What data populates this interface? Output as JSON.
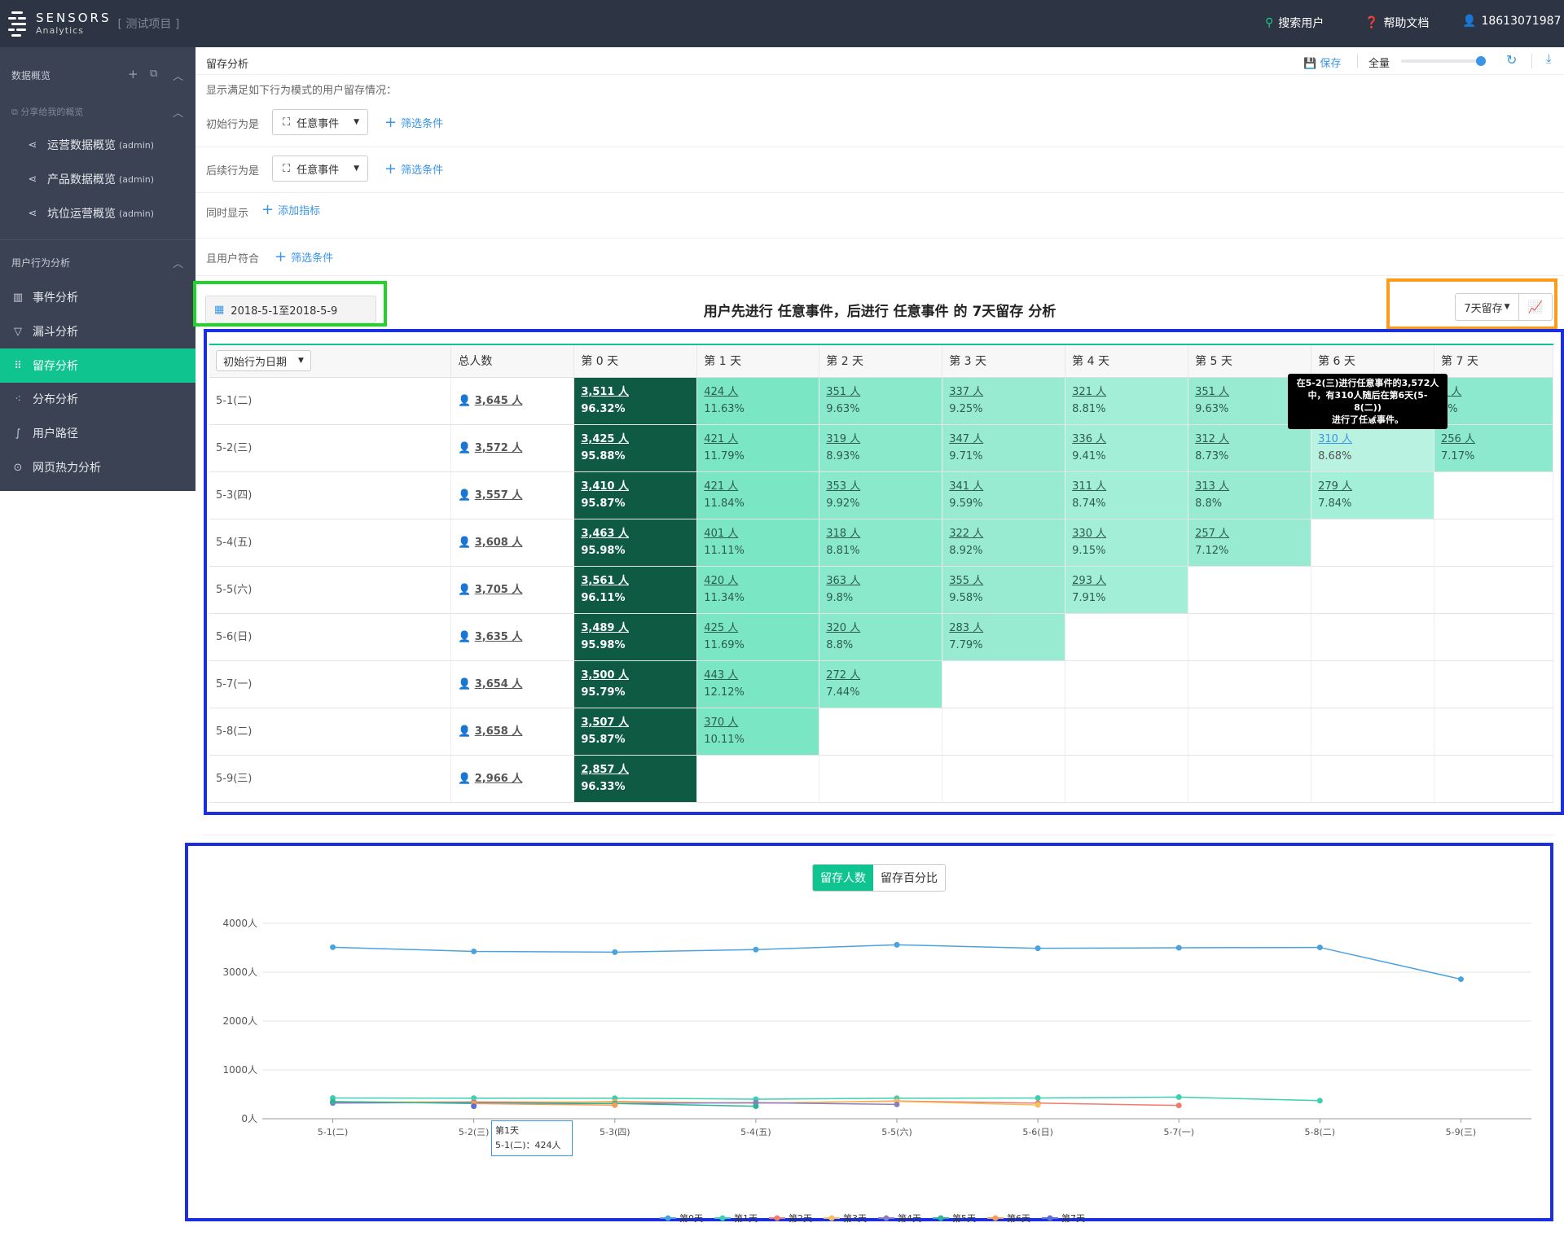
{
  "app": {
    "logo_line1": "SENSORS",
    "logo_line2": "Analytics",
    "project": "[ 测试项目 ]"
  },
  "topnav": {
    "search": "搜索用户",
    "help": "帮助文档",
    "user": "18613071987"
  },
  "sidebar": {
    "section1": "数据概览",
    "shared_title": "分享给我的概览",
    "shared_items": [
      {
        "label": "运营数据概览",
        "tag": "(admin)"
      },
      {
        "label": "产品数据概览",
        "tag": "(admin)"
      },
      {
        "label": "坑位运营概览",
        "tag": "(admin)"
      }
    ],
    "section2": "用户行为分析",
    "items": [
      "事件分析",
      "漏斗分析",
      "留存分析",
      "分布分析",
      "用户路径",
      "网页热力分析"
    ]
  },
  "page": {
    "title": "留存分析",
    "save": "保存",
    "scope": "全量",
    "description": "显示满足如下行为模式的用户留存情况：",
    "initial_label": "初始行为是",
    "followup_label": "后续行为是",
    "event_value": "任意事件",
    "filter_link": "筛选条件",
    "also_show_label": "同时显示",
    "add_metric": "添加指标",
    "user_match_label": "且用户符合",
    "date_range": "2018-5-1至2018-5-9",
    "chart_title": "用户先进行 任意事件，后进行 任意事件 的 7天留存 分析",
    "retention_select": "7天留存"
  },
  "table": {
    "date_dropdown": "初始行为日期",
    "headers": [
      "总人数",
      "第 0 天",
      "第 1 天",
      "第 2 天",
      "第 3 天",
      "第 4 天",
      "第 5 天",
      "第 6 天",
      "第 7 天"
    ],
    "rows": [
      {
        "date": "5-1(二)",
        "total": "3,645 人",
        "cells": [
          [
            "3,511 人",
            "96.32%"
          ],
          [
            "424 人",
            "11.63%"
          ],
          [
            "351 人",
            "9.63%"
          ],
          [
            "337 人",
            "9.25%"
          ],
          [
            "321 人",
            "8.81%"
          ],
          [
            "351 人",
            "9.63%"
          ],
          [
            "",
            ""
          ],
          [
            "6 人",
            "7%"
          ]
        ]
      },
      {
        "date": "5-2(三)",
        "total": "3,572 人",
        "cells": [
          [
            "3,425 人",
            "95.88%"
          ],
          [
            "421 人",
            "11.79%"
          ],
          [
            "319 人",
            "8.93%"
          ],
          [
            "347 人",
            "9.71%"
          ],
          [
            "336 人",
            "9.41%"
          ],
          [
            "312 人",
            "8.73%"
          ],
          [
            "310 人",
            "8.68%"
          ],
          [
            "256 人",
            "7.17%"
          ]
        ]
      },
      {
        "date": "5-3(四)",
        "total": "3,557 人",
        "cells": [
          [
            "3,410 人",
            "95.87%"
          ],
          [
            "421 人",
            "11.84%"
          ],
          [
            "353 人",
            "9.92%"
          ],
          [
            "341 人",
            "9.59%"
          ],
          [
            "311 人",
            "8.74%"
          ],
          [
            "313 人",
            "8.8%"
          ],
          [
            "279 人",
            "7.84%"
          ]
        ]
      },
      {
        "date": "5-4(五)",
        "total": "3,608 人",
        "cells": [
          [
            "3,463 人",
            "95.98%"
          ],
          [
            "401 人",
            "11.11%"
          ],
          [
            "318 人",
            "8.81%"
          ],
          [
            "322 人",
            "8.92%"
          ],
          [
            "330 人",
            "9.15%"
          ],
          [
            "257 人",
            "7.12%"
          ]
        ]
      },
      {
        "date": "5-5(六)",
        "total": "3,705 人",
        "cells": [
          [
            "3,561 人",
            "96.11%"
          ],
          [
            "420 人",
            "11.34%"
          ],
          [
            "363 人",
            "9.8%"
          ],
          [
            "355 人",
            "9.58%"
          ],
          [
            "293 人",
            "7.91%"
          ]
        ]
      },
      {
        "date": "5-6(日)",
        "total": "3,635 人",
        "cells": [
          [
            "3,489 人",
            "95.98%"
          ],
          [
            "425 人",
            "11.69%"
          ],
          [
            "320 人",
            "8.8%"
          ],
          [
            "283 人",
            "7.79%"
          ]
        ]
      },
      {
        "date": "5-7(一)",
        "total": "3,654 人",
        "cells": [
          [
            "3,500 人",
            "95.79%"
          ],
          [
            "443 人",
            "12.12%"
          ],
          [
            "272 人",
            "7.44%"
          ]
        ]
      },
      {
        "date": "5-8(二)",
        "total": "3,658 人",
        "cells": [
          [
            "3,507 人",
            "95.87%"
          ],
          [
            "370 人",
            "10.11%"
          ]
        ]
      },
      {
        "date": "5-9(三)",
        "total": "2,966 人",
        "cells": [
          [
            "2,857 人",
            "96.33%"
          ]
        ]
      }
    ],
    "tooltip_lines": [
      "在5-2(三)进行任意事件的3,572人",
      "中，有310人随后在第6天(5-8(二))",
      "进行了任意事件。"
    ]
  },
  "chart_toggle": {
    "count": "留存人数",
    "percent": "留存百分比"
  },
  "chart_tooltip": {
    "line1": "第1天",
    "line2": "5-1(二)：424人"
  },
  "chart_data": {
    "type": "line",
    "categories": [
      "5-1(二)",
      "5-2(三)",
      "5-3(四)",
      "5-4(五)",
      "5-5(六)",
      "5-6(日)",
      "5-7(一)",
      "5-8(二)",
      "5-9(三)"
    ],
    "ylim": [
      0,
      4000
    ],
    "y_ticks": [
      "0人",
      "1000人",
      "2000人",
      "3000人",
      "4000人"
    ],
    "series": [
      {
        "name": "第0天",
        "color": "#4aa3df",
        "values": [
          3511,
          3425,
          3410,
          3463,
          3561,
          3489,
          3500,
          3507,
          2857
        ]
      },
      {
        "name": "第1天",
        "color": "#3ccfb0",
        "values": [
          424,
          421,
          421,
          401,
          420,
          425,
          443,
          370
        ]
      },
      {
        "name": "第2天",
        "color": "#f07b6e",
        "values": [
          351,
          319,
          353,
          318,
          363,
          320,
          272
        ]
      },
      {
        "name": "第3天",
        "color": "#f3c15b",
        "values": [
          337,
          347,
          341,
          322,
          355,
          283
        ]
      },
      {
        "name": "第4天",
        "color": "#8e7cc3",
        "values": [
          321,
          336,
          311,
          330,
          293
        ]
      },
      {
        "name": "第5天",
        "color": "#2bb39b",
        "values": [
          351,
          312,
          313,
          257
        ]
      },
      {
        "name": "第6天",
        "color": "#f59d52",
        "values": [
          null,
          310,
          279
        ]
      },
      {
        "name": "第7天",
        "color": "#5b6fd6",
        "values": [
          null,
          256
        ]
      }
    ]
  }
}
